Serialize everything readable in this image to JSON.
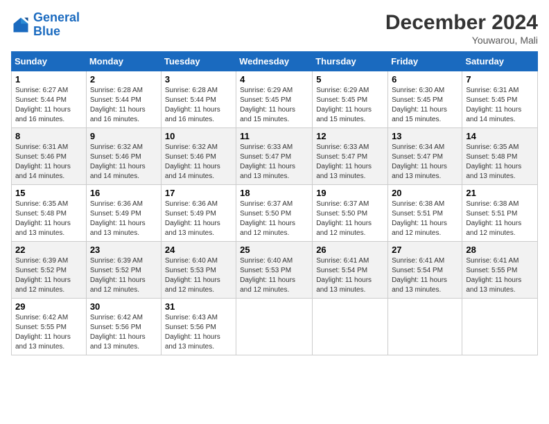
{
  "header": {
    "logo_general": "General",
    "logo_blue": "Blue",
    "month_year": "December 2024",
    "location": "Youwarou, Mali"
  },
  "days_of_week": [
    "Sunday",
    "Monday",
    "Tuesday",
    "Wednesday",
    "Thursday",
    "Friday",
    "Saturday"
  ],
  "weeks": [
    [
      {
        "day": "1",
        "sunrise": "6:27 AM",
        "sunset": "5:44 PM",
        "daylight": "11 hours and 16 minutes."
      },
      {
        "day": "2",
        "sunrise": "6:28 AM",
        "sunset": "5:44 PM",
        "daylight": "11 hours and 16 minutes."
      },
      {
        "day": "3",
        "sunrise": "6:28 AM",
        "sunset": "5:44 PM",
        "daylight": "11 hours and 16 minutes."
      },
      {
        "day": "4",
        "sunrise": "6:29 AM",
        "sunset": "5:45 PM",
        "daylight": "11 hours and 15 minutes."
      },
      {
        "day": "5",
        "sunrise": "6:29 AM",
        "sunset": "5:45 PM",
        "daylight": "11 hours and 15 minutes."
      },
      {
        "day": "6",
        "sunrise": "6:30 AM",
        "sunset": "5:45 PM",
        "daylight": "11 hours and 15 minutes."
      },
      {
        "day": "7",
        "sunrise": "6:31 AM",
        "sunset": "5:45 PM",
        "daylight": "11 hours and 14 minutes."
      }
    ],
    [
      {
        "day": "8",
        "sunrise": "6:31 AM",
        "sunset": "5:46 PM",
        "daylight": "11 hours and 14 minutes."
      },
      {
        "day": "9",
        "sunrise": "6:32 AM",
        "sunset": "5:46 PM",
        "daylight": "11 hours and 14 minutes."
      },
      {
        "day": "10",
        "sunrise": "6:32 AM",
        "sunset": "5:46 PM",
        "daylight": "11 hours and 14 minutes."
      },
      {
        "day": "11",
        "sunrise": "6:33 AM",
        "sunset": "5:47 PM",
        "daylight": "11 hours and 13 minutes."
      },
      {
        "day": "12",
        "sunrise": "6:33 AM",
        "sunset": "5:47 PM",
        "daylight": "11 hours and 13 minutes."
      },
      {
        "day": "13",
        "sunrise": "6:34 AM",
        "sunset": "5:47 PM",
        "daylight": "11 hours and 13 minutes."
      },
      {
        "day": "14",
        "sunrise": "6:35 AM",
        "sunset": "5:48 PM",
        "daylight": "11 hours and 13 minutes."
      }
    ],
    [
      {
        "day": "15",
        "sunrise": "6:35 AM",
        "sunset": "5:48 PM",
        "daylight": "11 hours and 13 minutes."
      },
      {
        "day": "16",
        "sunrise": "6:36 AM",
        "sunset": "5:49 PM",
        "daylight": "11 hours and 13 minutes."
      },
      {
        "day": "17",
        "sunrise": "6:36 AM",
        "sunset": "5:49 PM",
        "daylight": "11 hours and 13 minutes."
      },
      {
        "day": "18",
        "sunrise": "6:37 AM",
        "sunset": "5:50 PM",
        "daylight": "11 hours and 12 minutes."
      },
      {
        "day": "19",
        "sunrise": "6:37 AM",
        "sunset": "5:50 PM",
        "daylight": "11 hours and 12 minutes."
      },
      {
        "day": "20",
        "sunrise": "6:38 AM",
        "sunset": "5:51 PM",
        "daylight": "11 hours and 12 minutes."
      },
      {
        "day": "21",
        "sunrise": "6:38 AM",
        "sunset": "5:51 PM",
        "daylight": "11 hours and 12 minutes."
      }
    ],
    [
      {
        "day": "22",
        "sunrise": "6:39 AM",
        "sunset": "5:52 PM",
        "daylight": "11 hours and 12 minutes."
      },
      {
        "day": "23",
        "sunrise": "6:39 AM",
        "sunset": "5:52 PM",
        "daylight": "11 hours and 12 minutes."
      },
      {
        "day": "24",
        "sunrise": "6:40 AM",
        "sunset": "5:53 PM",
        "daylight": "11 hours and 12 minutes."
      },
      {
        "day": "25",
        "sunrise": "6:40 AM",
        "sunset": "5:53 PM",
        "daylight": "11 hours and 12 minutes."
      },
      {
        "day": "26",
        "sunrise": "6:41 AM",
        "sunset": "5:54 PM",
        "daylight": "11 hours and 13 minutes."
      },
      {
        "day": "27",
        "sunrise": "6:41 AM",
        "sunset": "5:54 PM",
        "daylight": "11 hours and 13 minutes."
      },
      {
        "day": "28",
        "sunrise": "6:41 AM",
        "sunset": "5:55 PM",
        "daylight": "11 hours and 13 minutes."
      }
    ],
    [
      {
        "day": "29",
        "sunrise": "6:42 AM",
        "sunset": "5:55 PM",
        "daylight": "11 hours and 13 minutes."
      },
      {
        "day": "30",
        "sunrise": "6:42 AM",
        "sunset": "5:56 PM",
        "daylight": "11 hours and 13 minutes."
      },
      {
        "day": "31",
        "sunrise": "6:43 AM",
        "sunset": "5:56 PM",
        "daylight": "11 hours and 13 minutes."
      },
      null,
      null,
      null,
      null
    ]
  ]
}
